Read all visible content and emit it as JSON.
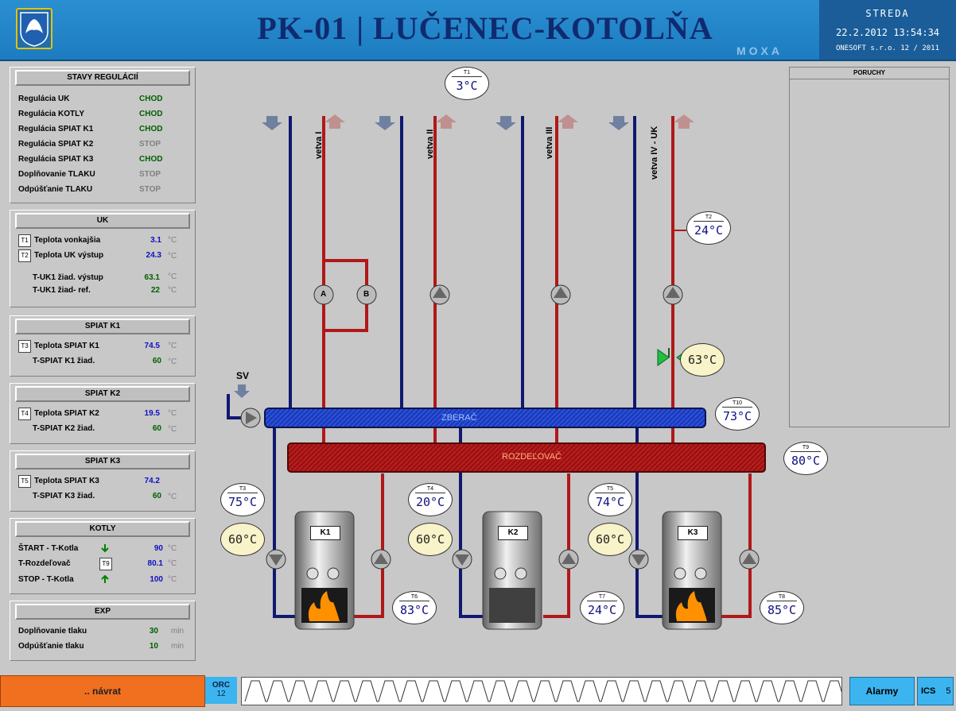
{
  "header": {
    "title": "PK-01 | LUČENEC-KOTOLŇA",
    "day": "STREDA",
    "datetime": "22.2.2012 13:54:34",
    "brand": "MOXA",
    "company": "ONESOFT s.r.o. 12 / 2011"
  },
  "stavy": {
    "title": "STAVY REGULÁCIÍ",
    "rows": [
      {
        "label": "Regulácia UK",
        "state": "CHOD"
      },
      {
        "label": "Regulácia KOTLY",
        "state": "CHOD"
      },
      {
        "label": "Regulácia SPIAT K1",
        "state": "CHOD"
      },
      {
        "label": "Regulácia SPIAT K2",
        "state": "STOP"
      },
      {
        "label": "Regulácia SPIAT K3",
        "state": "CHOD"
      },
      {
        "label": "Doplňovanie TLAKU",
        "state": "STOP"
      },
      {
        "label": "Odpúšťanie TLAKU",
        "state": "STOP"
      }
    ]
  },
  "uk": {
    "title": "UK",
    "t1_tag": "T1",
    "t1_label": "Teplota vonkajšia",
    "t1_val": "3.1",
    "t1_unit": "°C",
    "t2_tag": "T2",
    "t2_label": "Teplota UK výstup",
    "t2_val": "24.3",
    "t2_unit": "°C",
    "r3_label": "T-UK1 žiad. výstup",
    "r3_val": "63.1",
    "r3_unit": "°C",
    "r4_label": "T-UK1 žiad- ref.",
    "r4_val": "22",
    "r4_unit": "°C"
  },
  "k1": {
    "title": "SPIAT K1",
    "tag": "T3",
    "label": "Teplota SPIAT K1",
    "val": "74.5",
    "unit": "°C",
    "r2_label": "T-SPIAT K1 žiad.",
    "r2_val": "60",
    "r2_unit": "°C"
  },
  "k2": {
    "title": "SPIAT K2",
    "tag": "T4",
    "label": "Teplota SPIAT K2",
    "val": "19.5",
    "unit": "°C",
    "r2_label": "T-SPIAT K2 žiad.",
    "r2_val": "60",
    "r2_unit": "°C"
  },
  "k3": {
    "title": "SPIAT K3",
    "tag": "T5",
    "label": "Teplota SPIAT K3",
    "val": "74.2",
    "unit": "",
    "r2_label": "T-SPIAT K3 žiad.",
    "r2_val": "60",
    "r2_unit": "°C"
  },
  "kotly": {
    "title": "KOTLY",
    "r1_label": "ŠTART - T-Kotla",
    "r1_val": "90",
    "r1_unit": "°C",
    "r2_label": "T-Rozdeľovač",
    "r2_tag": "T9",
    "r2_val": "80.1",
    "r2_unit": "°C",
    "r3_label": "STOP - T-Kotla",
    "r3_val": "100",
    "r3_unit": "°C"
  },
  "exp": {
    "title": "EXP",
    "r1_label": "Doplňovanie tlaku",
    "r1_val": "30",
    "r1_unit": "min",
    "r2_label": "Odpúšťanie tlaku",
    "r2_val": "10",
    "r2_unit": "min"
  },
  "poruchy": {
    "title": "PORUCHY"
  },
  "diagram": {
    "branches": [
      "vetva I",
      "vetva II",
      "vetva III",
      "vetva IV - UK"
    ],
    "sv_label": "SV",
    "zberac": "ZBERAČ",
    "rozdelovac": "ROZDEĽOVAČ",
    "pump_a": "A",
    "pump_b": "B",
    "gauges": {
      "t1": {
        "id": "T1",
        "value": "3°C"
      },
      "t2": {
        "id": "T2",
        "value": "24°C"
      },
      "t3": {
        "id": "T3",
        "value": "75°C"
      },
      "t4": {
        "id": "T4",
        "value": "20°C"
      },
      "t5": {
        "id": "T5",
        "value": "74°C"
      },
      "t6": {
        "id": "T6",
        "value": "83°C"
      },
      "t7": {
        "id": "T7",
        "value": "24°C"
      },
      "t8": {
        "id": "T8",
        "value": "85°C"
      },
      "t9": {
        "id": "T9",
        "value": "80°C"
      },
      "t10": {
        "id": "T10",
        "value": "73°C"
      }
    },
    "setpoints": {
      "valve": "63°C",
      "k1": "60°C",
      "k2": "60°C",
      "k3": "60°C"
    },
    "boilers": [
      "K1",
      "K2",
      "K3"
    ]
  },
  "bottom": {
    "back": ".. návrat",
    "orc": "ORC",
    "orc_num": "12",
    "alarmy": "Alarmy",
    "ics": "ICS",
    "ics_num": "5"
  },
  "colors": {
    "supply": "#b01818",
    "return": "#101870",
    "accent": "#1d7cc0",
    "back_button": "#f07020"
  }
}
